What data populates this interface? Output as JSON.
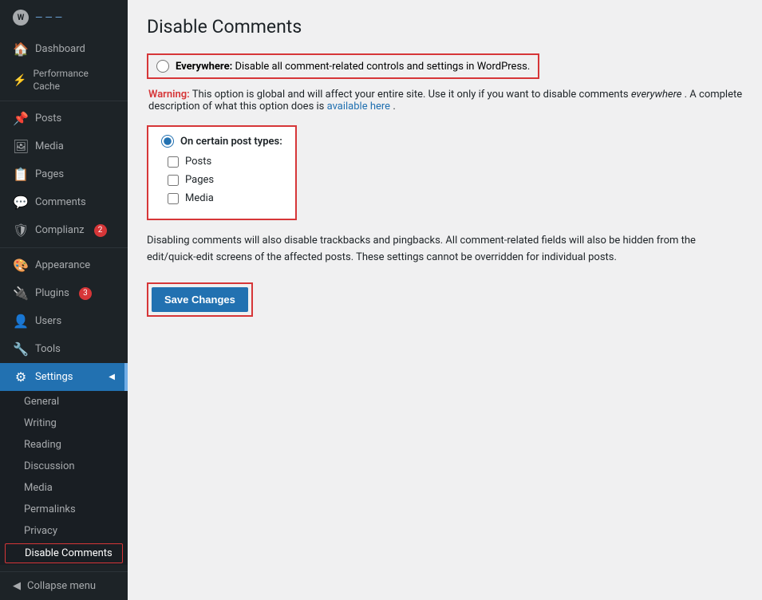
{
  "sidebar": {
    "logo_text": "W",
    "site_name": "— — —",
    "items": [
      {
        "id": "dashboard",
        "label": "Dashboard",
        "icon": "⬜",
        "badge": null
      },
      {
        "id": "performance-cache",
        "label": "Performance Cache",
        "icon": "⚙",
        "badge": null
      },
      {
        "id": "posts",
        "label": "Posts",
        "icon": "📄",
        "badge": null
      },
      {
        "id": "media",
        "label": "Media",
        "icon": "🖼",
        "badge": null
      },
      {
        "id": "pages",
        "label": "Pages",
        "icon": "📃",
        "badge": null
      },
      {
        "id": "comments",
        "label": "Comments",
        "icon": "💬",
        "badge": null
      },
      {
        "id": "complianz",
        "label": "Complianz",
        "icon": "🛡",
        "badge": "2"
      },
      {
        "id": "appearance",
        "label": "Appearance",
        "icon": "🎨",
        "badge": null
      },
      {
        "id": "plugins",
        "label": "Plugins",
        "icon": "🔌",
        "badge": "3"
      },
      {
        "id": "users",
        "label": "Users",
        "icon": "👤",
        "badge": null
      },
      {
        "id": "tools",
        "label": "Tools",
        "icon": "🔧",
        "badge": null
      },
      {
        "id": "settings",
        "label": "Settings",
        "icon": "⚙",
        "badge": null,
        "active": true
      }
    ],
    "submenu": [
      {
        "id": "general",
        "label": "General"
      },
      {
        "id": "writing",
        "label": "Writing"
      },
      {
        "id": "reading",
        "label": "Reading"
      },
      {
        "id": "discussion",
        "label": "Discussion"
      },
      {
        "id": "media",
        "label": "Media"
      },
      {
        "id": "permalinks",
        "label": "Permalinks"
      },
      {
        "id": "privacy",
        "label": "Privacy"
      },
      {
        "id": "disable-comments",
        "label": "Disable Comments",
        "active": true
      }
    ],
    "collapse_label": "Collapse menu"
  },
  "main": {
    "page_title": "Disable Comments",
    "everywhere_option": {
      "label_strong": "Everywhere:",
      "label_text": " Disable all comment-related controls and settings in WordPress."
    },
    "warning": {
      "label": "Warning:",
      "text": " This option is global and will affect your entire site. Use it only if you want to disable comments ",
      "italic": "everywhere",
      "text2": ". A complete description of what this option does is ",
      "link_text": "available here",
      "text3": "."
    },
    "post_types_option": {
      "label": "On certain post types:"
    },
    "checkboxes": [
      {
        "id": "posts",
        "label": "Posts"
      },
      {
        "id": "pages",
        "label": "Pages"
      },
      {
        "id": "media",
        "label": "Media"
      }
    ],
    "description": "Disabling comments will also disable trackbacks and pingbacks. All comment-related fields will also be hidden from the edit/quick-edit screens of the affected posts. These settings cannot be overridden for individual posts.",
    "save_button_label": "Save Changes"
  }
}
